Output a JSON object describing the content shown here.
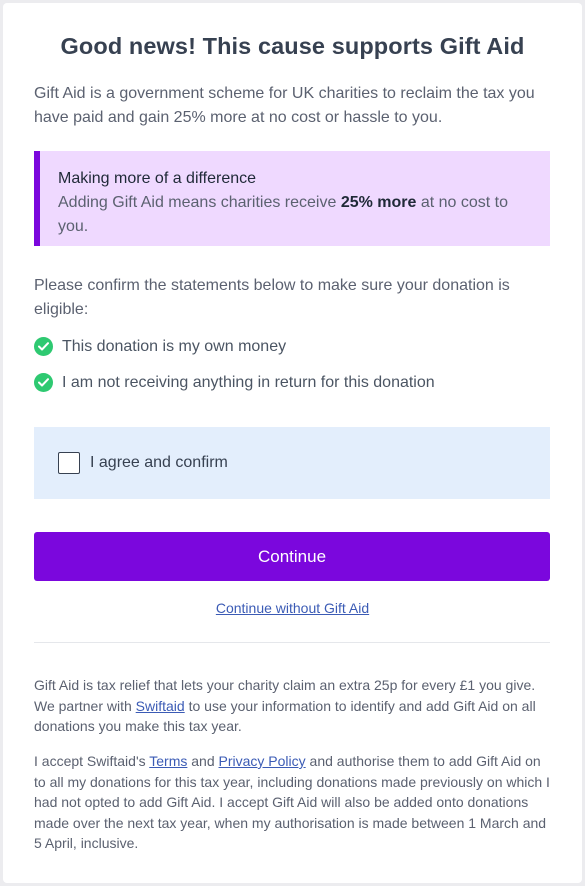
{
  "title": "Good news! This cause supports Gift Aid",
  "intro": "Gift Aid is a government scheme for UK charities to reclaim the tax you have paid and gain 25% more at no cost or hassle to you.",
  "callout": {
    "title": "Making more of a difference",
    "body_before": "Adding Gift Aid means charities receive ",
    "body_bold": "25% more",
    "body_after": " at no cost to you."
  },
  "confirm_text": "Please confirm the statements below to make sure your donation is eligible:",
  "statements": [
    "This donation is my own money",
    "I am not receiving anything in return for this donation"
  ],
  "agree": {
    "label": "I agree and confirm",
    "checked": false
  },
  "continue_label": "Continue",
  "skip_label": "Continue without Gift Aid",
  "fine_print_1": {
    "before": "Gift Aid is tax relief that lets your charity claim an extra 25p for every £1 you give. We partner with ",
    "link": "Swiftaid",
    "after": " to use your information to identify and add Gift Aid on all donations you make this tax year."
  },
  "fine_print_2": {
    "before": "I accept Swiftaid's ",
    "terms": "Terms",
    "and": " and ",
    "privacy": "Privacy Policy",
    "after": " and authorise them to add Gift Aid on to all my donations for this tax year, including donations made previously on which I had not opted to add Gift Aid. I accept Gift Aid will also be added onto donations made over the next tax year, when my authorisation is made between 1 March and 5 April, inclusive."
  },
  "colors": {
    "accent": "#7b07dd",
    "callout_bg": "#efd9ff",
    "agree_bg": "#e3eefc",
    "check": "#2ec971",
    "link": "#3b5bb5"
  }
}
